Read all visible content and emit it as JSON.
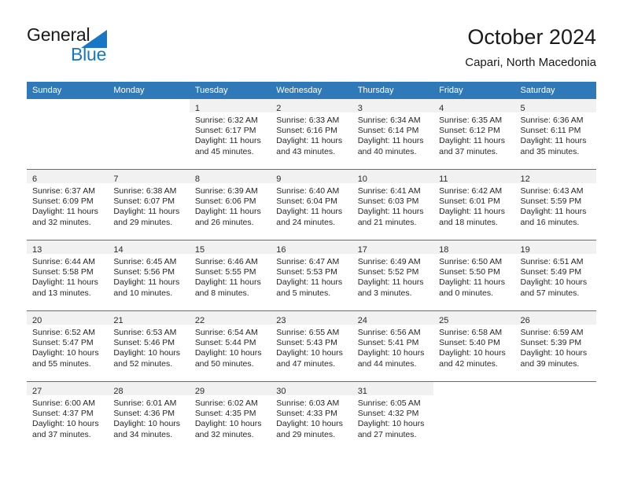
{
  "brand": {
    "name_part1": "General",
    "name_part2": "Blue",
    "triangle_color": "#1877c4"
  },
  "header": {
    "title": "October 2024",
    "subtitle": "Capari, North Macedonia"
  },
  "theme": {
    "header_blue": "#3079b9",
    "daynum_band": "#f1f1f1",
    "text": "#262626"
  },
  "calendar": {
    "weekday_headers": [
      "Sunday",
      "Monday",
      "Tuesday",
      "Wednesday",
      "Thursday",
      "Friday",
      "Saturday"
    ],
    "weeks": [
      [
        {
          "empty": true
        },
        {
          "empty": true
        },
        {
          "day": "1",
          "sunrise": "Sunrise: 6:32 AM",
          "sunset": "Sunset: 6:17 PM",
          "daylight1": "Daylight: 11 hours",
          "daylight2": "and 45 minutes."
        },
        {
          "day": "2",
          "sunrise": "Sunrise: 6:33 AM",
          "sunset": "Sunset: 6:16 PM",
          "daylight1": "Daylight: 11 hours",
          "daylight2": "and 43 minutes."
        },
        {
          "day": "3",
          "sunrise": "Sunrise: 6:34 AM",
          "sunset": "Sunset: 6:14 PM",
          "daylight1": "Daylight: 11 hours",
          "daylight2": "and 40 minutes."
        },
        {
          "day": "4",
          "sunrise": "Sunrise: 6:35 AM",
          "sunset": "Sunset: 6:12 PM",
          "daylight1": "Daylight: 11 hours",
          "daylight2": "and 37 minutes."
        },
        {
          "day": "5",
          "sunrise": "Sunrise: 6:36 AM",
          "sunset": "Sunset: 6:11 PM",
          "daylight1": "Daylight: 11 hours",
          "daylight2": "and 35 minutes."
        }
      ],
      [
        {
          "day": "6",
          "sunrise": "Sunrise: 6:37 AM",
          "sunset": "Sunset: 6:09 PM",
          "daylight1": "Daylight: 11 hours",
          "daylight2": "and 32 minutes."
        },
        {
          "day": "7",
          "sunrise": "Sunrise: 6:38 AM",
          "sunset": "Sunset: 6:07 PM",
          "daylight1": "Daylight: 11 hours",
          "daylight2": "and 29 minutes."
        },
        {
          "day": "8",
          "sunrise": "Sunrise: 6:39 AM",
          "sunset": "Sunset: 6:06 PM",
          "daylight1": "Daylight: 11 hours",
          "daylight2": "and 26 minutes."
        },
        {
          "day": "9",
          "sunrise": "Sunrise: 6:40 AM",
          "sunset": "Sunset: 6:04 PM",
          "daylight1": "Daylight: 11 hours",
          "daylight2": "and 24 minutes."
        },
        {
          "day": "10",
          "sunrise": "Sunrise: 6:41 AM",
          "sunset": "Sunset: 6:03 PM",
          "daylight1": "Daylight: 11 hours",
          "daylight2": "and 21 minutes."
        },
        {
          "day": "11",
          "sunrise": "Sunrise: 6:42 AM",
          "sunset": "Sunset: 6:01 PM",
          "daylight1": "Daylight: 11 hours",
          "daylight2": "and 18 minutes."
        },
        {
          "day": "12",
          "sunrise": "Sunrise: 6:43 AM",
          "sunset": "Sunset: 5:59 PM",
          "daylight1": "Daylight: 11 hours",
          "daylight2": "and 16 minutes."
        }
      ],
      [
        {
          "day": "13",
          "sunrise": "Sunrise: 6:44 AM",
          "sunset": "Sunset: 5:58 PM",
          "daylight1": "Daylight: 11 hours",
          "daylight2": "and 13 minutes."
        },
        {
          "day": "14",
          "sunrise": "Sunrise: 6:45 AM",
          "sunset": "Sunset: 5:56 PM",
          "daylight1": "Daylight: 11 hours",
          "daylight2": "and 10 minutes."
        },
        {
          "day": "15",
          "sunrise": "Sunrise: 6:46 AM",
          "sunset": "Sunset: 5:55 PM",
          "daylight1": "Daylight: 11 hours",
          "daylight2": "and 8 minutes."
        },
        {
          "day": "16",
          "sunrise": "Sunrise: 6:47 AM",
          "sunset": "Sunset: 5:53 PM",
          "daylight1": "Daylight: 11 hours",
          "daylight2": "and 5 minutes."
        },
        {
          "day": "17",
          "sunrise": "Sunrise: 6:49 AM",
          "sunset": "Sunset: 5:52 PM",
          "daylight1": "Daylight: 11 hours",
          "daylight2": "and 3 minutes."
        },
        {
          "day": "18",
          "sunrise": "Sunrise: 6:50 AM",
          "sunset": "Sunset: 5:50 PM",
          "daylight1": "Daylight: 11 hours",
          "daylight2": "and 0 minutes."
        },
        {
          "day": "19",
          "sunrise": "Sunrise: 6:51 AM",
          "sunset": "Sunset: 5:49 PM",
          "daylight1": "Daylight: 10 hours",
          "daylight2": "and 57 minutes."
        }
      ],
      [
        {
          "day": "20",
          "sunrise": "Sunrise: 6:52 AM",
          "sunset": "Sunset: 5:47 PM",
          "daylight1": "Daylight: 10 hours",
          "daylight2": "and 55 minutes."
        },
        {
          "day": "21",
          "sunrise": "Sunrise: 6:53 AM",
          "sunset": "Sunset: 5:46 PM",
          "daylight1": "Daylight: 10 hours",
          "daylight2": "and 52 minutes."
        },
        {
          "day": "22",
          "sunrise": "Sunrise: 6:54 AM",
          "sunset": "Sunset: 5:44 PM",
          "daylight1": "Daylight: 10 hours",
          "daylight2": "and 50 minutes."
        },
        {
          "day": "23",
          "sunrise": "Sunrise: 6:55 AM",
          "sunset": "Sunset: 5:43 PM",
          "daylight1": "Daylight: 10 hours",
          "daylight2": "and 47 minutes."
        },
        {
          "day": "24",
          "sunrise": "Sunrise: 6:56 AM",
          "sunset": "Sunset: 5:41 PM",
          "daylight1": "Daylight: 10 hours",
          "daylight2": "and 44 minutes."
        },
        {
          "day": "25",
          "sunrise": "Sunrise: 6:58 AM",
          "sunset": "Sunset: 5:40 PM",
          "daylight1": "Daylight: 10 hours",
          "daylight2": "and 42 minutes."
        },
        {
          "day": "26",
          "sunrise": "Sunrise: 6:59 AM",
          "sunset": "Sunset: 5:39 PM",
          "daylight1": "Daylight: 10 hours",
          "daylight2": "and 39 minutes."
        }
      ],
      [
        {
          "day": "27",
          "sunrise": "Sunrise: 6:00 AM",
          "sunset": "Sunset: 4:37 PM",
          "daylight1": "Daylight: 10 hours",
          "daylight2": "and 37 minutes."
        },
        {
          "day": "28",
          "sunrise": "Sunrise: 6:01 AM",
          "sunset": "Sunset: 4:36 PM",
          "daylight1": "Daylight: 10 hours",
          "daylight2": "and 34 minutes."
        },
        {
          "day": "29",
          "sunrise": "Sunrise: 6:02 AM",
          "sunset": "Sunset: 4:35 PM",
          "daylight1": "Daylight: 10 hours",
          "daylight2": "and 32 minutes."
        },
        {
          "day": "30",
          "sunrise": "Sunrise: 6:03 AM",
          "sunset": "Sunset: 4:33 PM",
          "daylight1": "Daylight: 10 hours",
          "daylight2": "and 29 minutes."
        },
        {
          "day": "31",
          "sunrise": "Sunrise: 6:05 AM",
          "sunset": "Sunset: 4:32 PM",
          "daylight1": "Daylight: 10 hours",
          "daylight2": "and 27 minutes."
        },
        {
          "empty": true
        },
        {
          "empty": true
        }
      ]
    ]
  }
}
